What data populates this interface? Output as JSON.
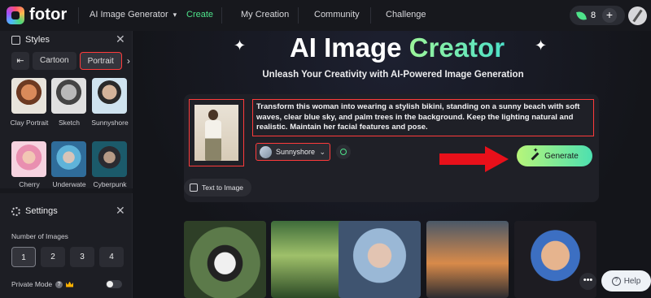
{
  "nav": {
    "logo": "fotor",
    "items": [
      "AI Image Generator",
      "Create",
      "My Creation",
      "Community",
      "Challenge"
    ],
    "credits": "8",
    "plus": "+"
  },
  "styles_panel": {
    "title": "Styles",
    "close": "✕",
    "tabs": [
      "Cartoon",
      "Portrait"
    ],
    "selected_tab": "Portrait",
    "prev": "⇤",
    "next": "›",
    "thumbs": [
      "Clay Portrait",
      "Sketch",
      "Sunnyshore",
      "Cherry",
      "Underwate",
      "Cyberpunk"
    ]
  },
  "settings_panel": {
    "title": "Settings",
    "close": "✕",
    "number_label": "Number of Images",
    "numbers": [
      "1",
      "2",
      "3",
      "4"
    ],
    "selected_number": "1",
    "private_mode": "Private Mode",
    "help": "?"
  },
  "hero": {
    "title_white": "AI Image ",
    "title_green": "Creator",
    "subtitle": "Unleash Your Creativity with AI-Powered Image Generation"
  },
  "prompt": {
    "text": "Transform this woman into wearing a stylish bikini, standing on a sunny beach with soft waves, clear blue sky, and palm trees in the background. Keep the lighting natural and realistic. Maintain her facial features and pose.",
    "style_value": "Sunnyshore",
    "generate_label": "Generate",
    "text_to_image": "Text to Image"
  },
  "help_button": "Help",
  "more": "•••",
  "colors": {
    "accent": "#4ee38a",
    "highlight": "#ff3b3b",
    "arrow": "#e8101a"
  },
  "icons": [
    "fotor-logo-icon",
    "leaf-icon",
    "avatar-icon",
    "styles-icon",
    "close-icon",
    "gear-icon",
    "wand-icon",
    "image-icon",
    "help-icon",
    "crown-icon",
    "arrow-icon"
  ]
}
